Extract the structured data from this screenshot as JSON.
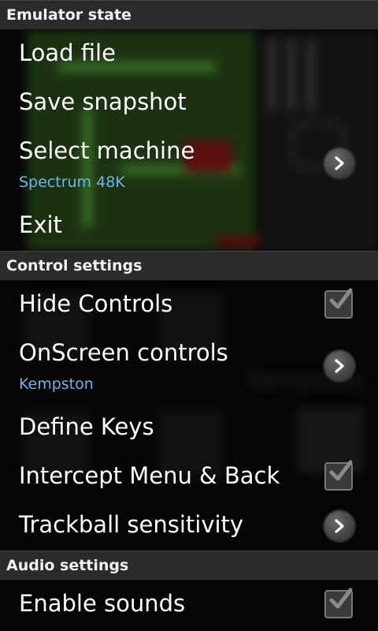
{
  "sections": {
    "emulator": {
      "header": "Emulator state",
      "load_file": "Load file",
      "save_snapshot": "Save snapshot",
      "select_machine": "Select machine",
      "select_machine_summary": "Spectrum 48K",
      "exit": "Exit"
    },
    "control": {
      "header": "Control settings",
      "hide_controls": "Hide Controls",
      "hide_controls_checked": true,
      "onscreen_controls": "OnScreen controls",
      "onscreen_controls_summary": "Kempston",
      "define_keys": "Define Keys",
      "intercept_menu": "Intercept Menu & Back",
      "intercept_menu_checked": true,
      "trackball_sensitivity": "Trackball sensitivity"
    },
    "audio": {
      "header": "Audio settings",
      "enable_sounds": "Enable sounds",
      "enable_sounds_checked": true
    }
  },
  "background": {
    "overlay_label": "Kempston"
  },
  "colors": {
    "header_bg": "#2b2b2b",
    "summary_text": "#6fb6e8",
    "item_text": "#ffffff"
  }
}
